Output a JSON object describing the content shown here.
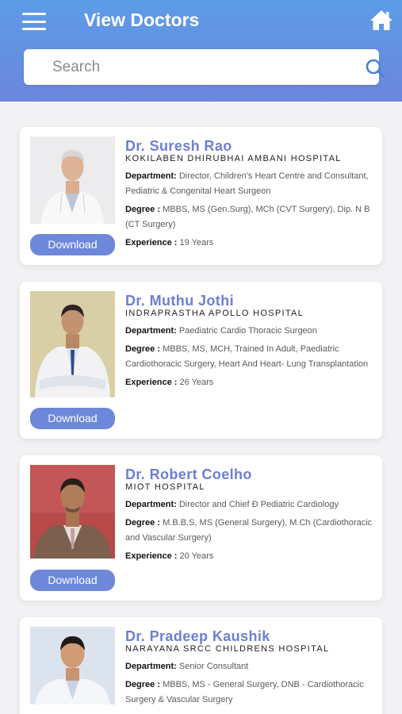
{
  "header": {
    "title": "View Doctors",
    "search_placeholder": "Search"
  },
  "labels": {
    "department": "Department:",
    "degree": "Degree :",
    "experience": "Experience :",
    "download": "Download"
  },
  "doctors": [
    {
      "name": "Dr. Suresh Rao",
      "hospital": "KOKILABEN DHIRUBHAI AMBANI HOSPITAL",
      "department": "Director, Children's Heart Centre and Consultant, Pediatric & Congenital Heart Surgeon",
      "degree": "MBBS, MS (Gen.Surg), MCh (CVT Surgery), Dip. N B (CT Surgery)",
      "experience": "19 Years"
    },
    {
      "name": "Dr. Muthu Jothi",
      "hospital": "INDRAPRASTHA APOLLO HOSPITAL",
      "department": "Paediatric Cardio Thoracic Surgeon",
      "degree": "MBBS, MS, MCH, Trained In Adult, Paediatric Cardiothoracic Surgery, Heart And Heart- Lung Transplantation",
      "experience": "26 Years"
    },
    {
      "name": "Dr. Robert Coelho",
      "hospital": "MIOT HOSPITAL",
      "department": "Director and Chief Ð Pediatric Cardiology",
      "degree": "M.B.B.S, MS (General Surgery), M.Ch (Cardiothoracic and Vascular Surgery)",
      "experience": "20 Years"
    },
    {
      "name": "Dr. Pradeep Kaushik",
      "hospital": "NARAYANA SRCC CHILDRENS HOSPITAL",
      "department": "Senior Consultant",
      "degree": "MBBS, MS - General Surgery, DNB - Cardiothoracic Surgery & Vascular Surgery",
      "experience": ""
    }
  ],
  "colors": {
    "header_top": "#5d9ce6",
    "header_bottom": "#6b86de",
    "accent": "#6c7fd3",
    "button": "#6d88d9"
  },
  "icons": [
    "menu-icon",
    "home-icon",
    "search-icon"
  ]
}
